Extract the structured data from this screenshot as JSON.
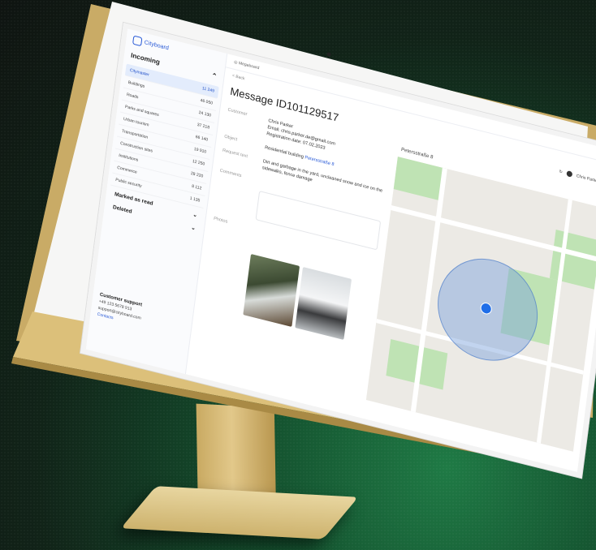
{
  "app": {
    "logo_text": "Cityboard",
    "breadcrumb": "Megaboard"
  },
  "sidebar": {
    "section_title": "Incoming",
    "items": [
      {
        "label": "Citymaster",
        "count": "11 249",
        "active": true
      },
      {
        "label": "Buildings",
        "count": "46 050"
      },
      {
        "label": "Roads",
        "count": "24 130"
      },
      {
        "label": "Parks and squares",
        "count": "37 218"
      },
      {
        "label": "Urban tourism",
        "count": "66 140"
      },
      {
        "label": "Transportation",
        "count": "19 910"
      },
      {
        "label": "Construction sites",
        "count": "12 250"
      },
      {
        "label": "Institutions",
        "count": "28 220"
      },
      {
        "label": "Commerce",
        "count": "8 112"
      },
      {
        "label": "Public security",
        "count": "1 135"
      }
    ],
    "marked_as_read": "Marked as read",
    "deleted": "Deleted",
    "support": {
      "title": "Customer support",
      "phone": "+49 123 5678 913",
      "email": "support@cityboard.com",
      "link": "Contacts"
    }
  },
  "main": {
    "back": "< Back",
    "title": "Message ID101129517",
    "user_name": "Chris Parker",
    "fields": [
      {
        "key": "Customer",
        "value": "Chris Parker\nEmail: chris.parker.de@gmail.com\nRegistration date: 07.02.2023"
      },
      {
        "key": "Object",
        "value": "Residential building "
      },
      {
        "key": "Request text",
        "value": "Dirt and garbage in the yard, uncleaned snow and ice on the sidewalks, fence damage"
      },
      {
        "key": "Comments",
        "value": ""
      },
      {
        "key": "Photos",
        "value": ""
      }
    ],
    "object_link": "Petersstraße 8",
    "map_title": "Petersstraße 8"
  },
  "colors": {
    "accent": "#2a5bd7",
    "gold": "#dcc07a",
    "map_circle": "#78a0dc"
  }
}
